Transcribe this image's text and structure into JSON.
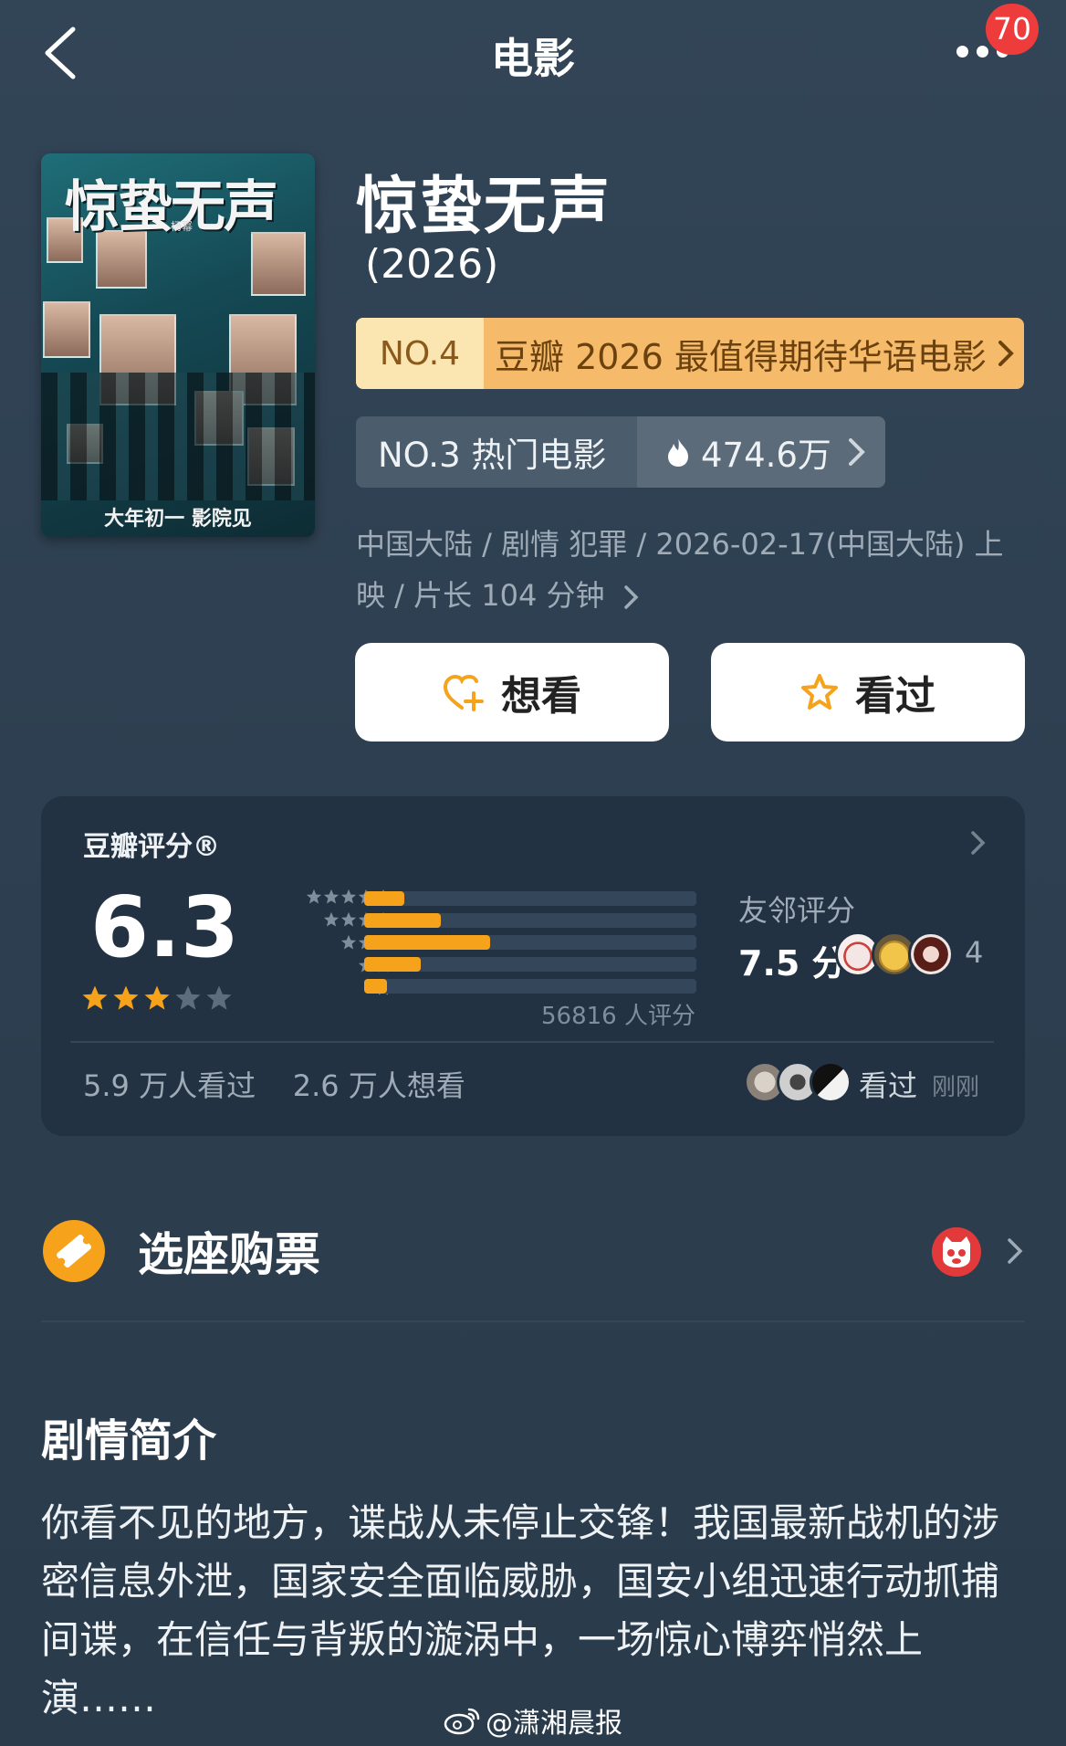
{
  "header": {
    "title": "电影",
    "notification_count": "70"
  },
  "poster": {
    "title": "惊蛰无声",
    "caption": "大年初一 影院见",
    "tag": "杨幂"
  },
  "movie": {
    "title": "惊蛰无声",
    "year": "(2026)",
    "rank_badge": {
      "no": "NO.4",
      "text": "豆瓣 2026 最值得期待华语电影"
    },
    "hot": {
      "rank": "NO.3 热门电影",
      "heat": "474.6万"
    },
    "meta": "中国大陆 / 剧情 犯罪 / 2026-02-17(中国大陆) 上映 / 片长 104 分钟",
    "buttons": {
      "want": "想看",
      "seen": "看过"
    }
  },
  "rating": {
    "label": "豆瓣评分®",
    "score": "6.3",
    "stars_filled": 3,
    "stars_total": 5,
    "distribution": [
      {
        "stars": 5,
        "fraction": 0.12
      },
      {
        "stars": 4,
        "fraction": 0.23
      },
      {
        "stars": 3,
        "fraction": 0.38
      },
      {
        "stars": 2,
        "fraction": 0.17
      },
      {
        "stars": 1,
        "fraction": 0.07
      }
    ],
    "count_text": "56816 人评分",
    "friends": {
      "label": "友邻评分",
      "score": "7.5 分",
      "count": "4"
    },
    "seen_text": "5.9 万人看过",
    "want_text": "2.6 万人想看",
    "recent_action": "看过",
    "recent_time": "刚刚"
  },
  "tickets": {
    "label": "选座购票"
  },
  "synopsis": {
    "heading": "剧情简介",
    "text": "你看不见的地方，谍战从未停止交锋！我国最新战机的涉密信息外泄，国家安全面临威胁，国安小组迅速行动抓捕间谍，在信任与背叛的漩涡中，一场惊心博弈悄然上演……"
  },
  "watermark": {
    "text": "@潇湘晨报"
  },
  "colors": {
    "background": "#2e4052",
    "card": "#223243",
    "accent_orange": "#f6a21b",
    "rank_badge": "#f5ba6a"
  }
}
